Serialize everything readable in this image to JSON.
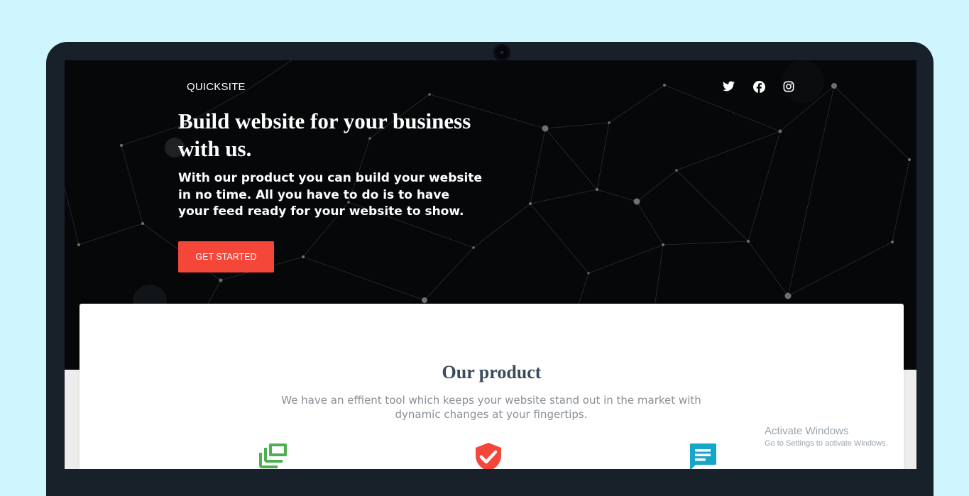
{
  "header": {
    "brand": "QUICKSITE",
    "social": [
      {
        "icon": "twitter-icon"
      },
      {
        "icon": "facebook-icon"
      },
      {
        "icon": "instagram-icon"
      }
    ]
  },
  "hero": {
    "title": "Build website for your business with us.",
    "text": "With our product you can build your website in no time. All you have to do is to have your feed ready for your website to show.",
    "cta_label": "GET STARTED"
  },
  "product": {
    "title": "Our product",
    "description": "We have an effient tool which keeps your website stand out in the market with dynamic changes at your fingertips.",
    "features": [
      {
        "icon": "stacked-layers-icon",
        "color": "#4caf50"
      },
      {
        "icon": "shield-check-icon",
        "color": "#f4473a"
      },
      {
        "icon": "chat-message-icon",
        "color": "#16a6c9"
      }
    ]
  },
  "watermark": {
    "title": "Activate Windows",
    "subtitle": "Go to Settings to activate Windows."
  },
  "colors": {
    "page_bg": "#cff5fe",
    "hero_bg": "#050708",
    "accent": "#f4473a",
    "title_dark": "#3a4a5a"
  }
}
